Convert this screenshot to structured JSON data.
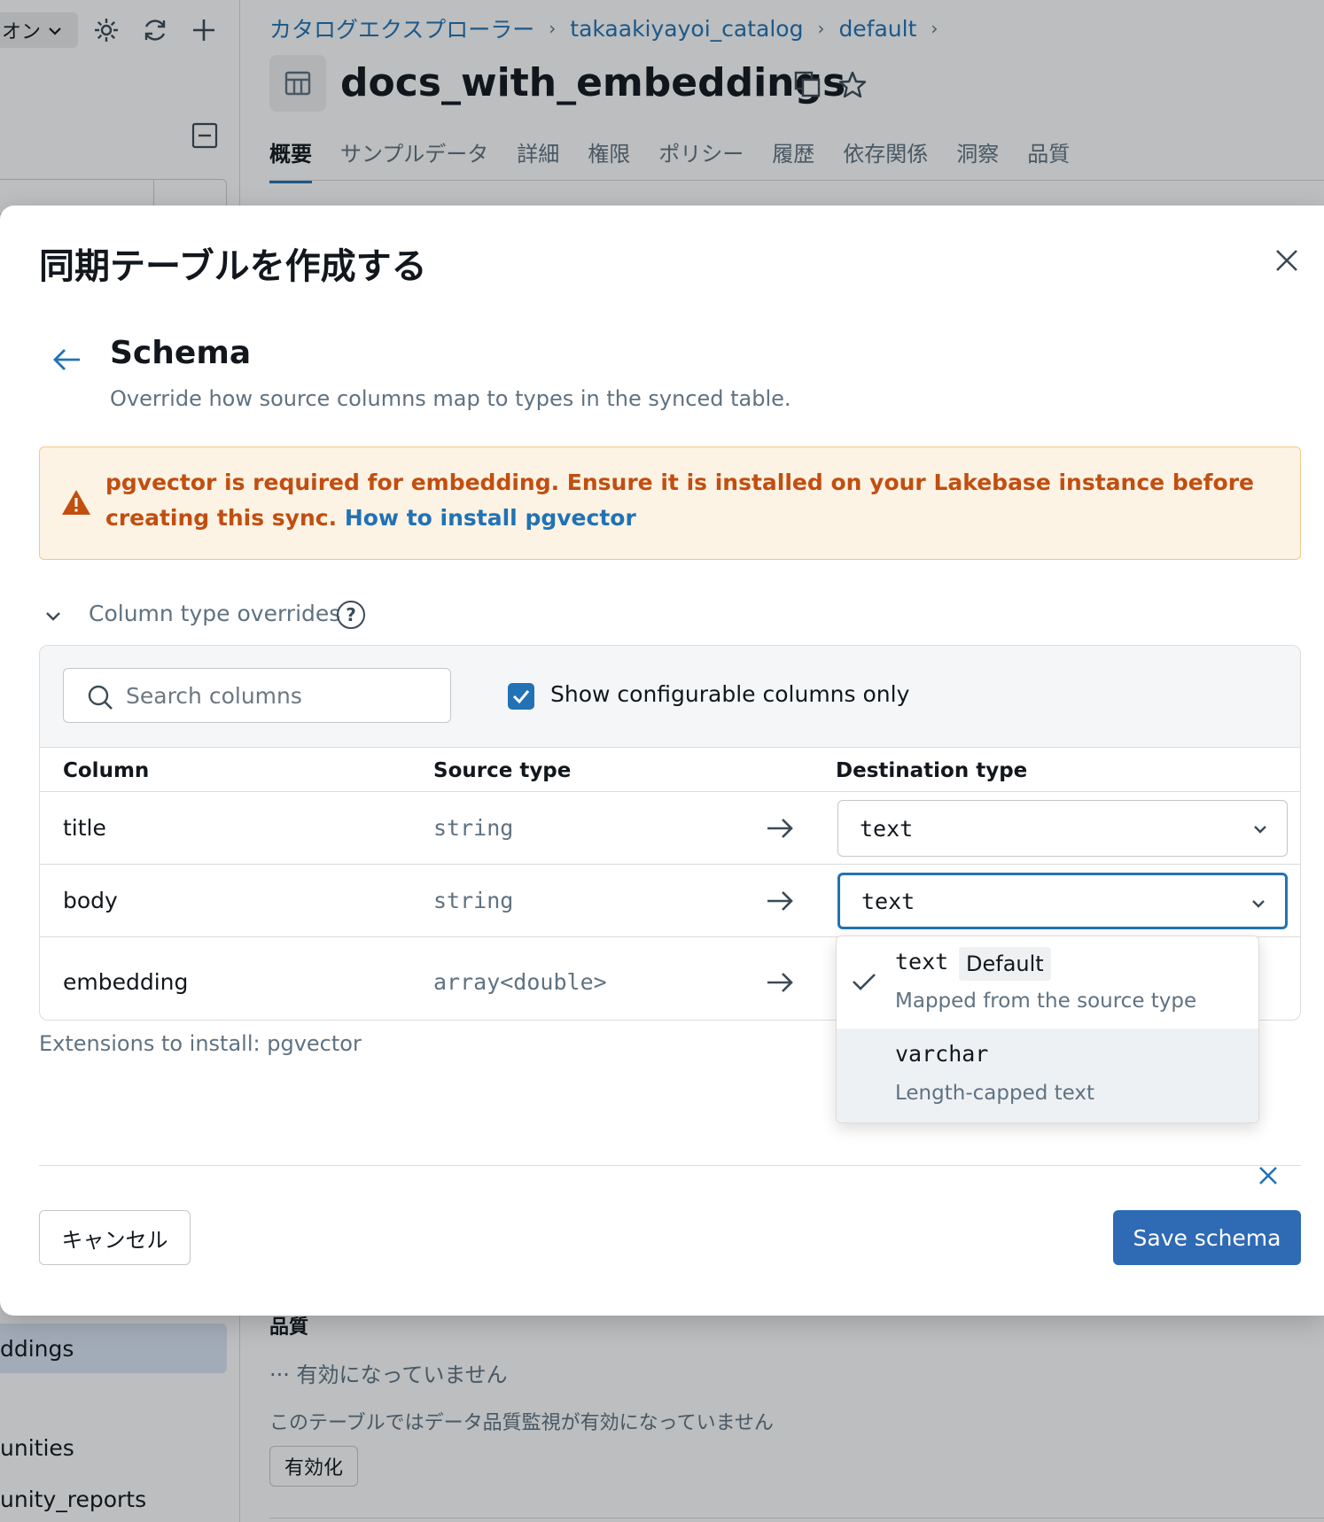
{
  "sidebar": {
    "language_label": "オン",
    "items": [
      {
        "label": "ddings"
      },
      {
        "label": "unities"
      },
      {
        "label": "unity_reports"
      }
    ]
  },
  "breadcrumb": {
    "items": [
      "カタログエクスプローラー",
      "takaakiyayoi_catalog",
      "default"
    ]
  },
  "page": {
    "title": "docs_with_embeddings",
    "tabs": [
      "概要",
      "サンプルデータ",
      "詳細",
      "権限",
      "ポリシー",
      "履歴",
      "依存関係",
      "洞察",
      "品質"
    ]
  },
  "quality_section": {
    "heading": "品質",
    "status": "··· 有効になっていません",
    "description": "このテーブルではデータ品質監視が有効になっていません",
    "enable_label": "有効化"
  },
  "modal": {
    "title": "同期テーブルを作成する",
    "heading": "Schema",
    "subtitle": "Override how source columns map to types in the synced table.",
    "alert": {
      "text": "pgvector is required for embedding. Ensure it is installed on your Lakebase instance before creating this sync.",
      "link": "How to install pgvector"
    },
    "overrides_label": "Column type overrides",
    "help_glyph": "?",
    "search": {
      "placeholder": "Search columns",
      "value": ""
    },
    "show_configurable": {
      "label": "Show configurable columns only",
      "checked": true
    },
    "columns": {
      "column": "Column",
      "source_type": "Source type",
      "destination_type": "Destination type"
    },
    "rows": [
      {
        "name": "title",
        "source": "string",
        "destination": "text"
      },
      {
        "name": "body",
        "source": "string",
        "destination": "text"
      },
      {
        "name": "embedding",
        "source": "array<double>",
        "destination": ""
      }
    ],
    "dropdown_options": [
      {
        "title": "text",
        "badge": "Default",
        "description": "Mapped from the source type",
        "selected": true
      },
      {
        "title": "varchar",
        "badge": "",
        "description": "Length-capped text",
        "selected": false
      }
    ],
    "extensions_note": "Extensions to install: pgvector",
    "cancel_label": "キャンセル",
    "save_label": "Save schema"
  },
  "colors": {
    "accent": "#2272b4",
    "primary_button": "#2f6ab4",
    "warning_text": "#c24e0f",
    "warning_bg": "#fcf3e5"
  }
}
